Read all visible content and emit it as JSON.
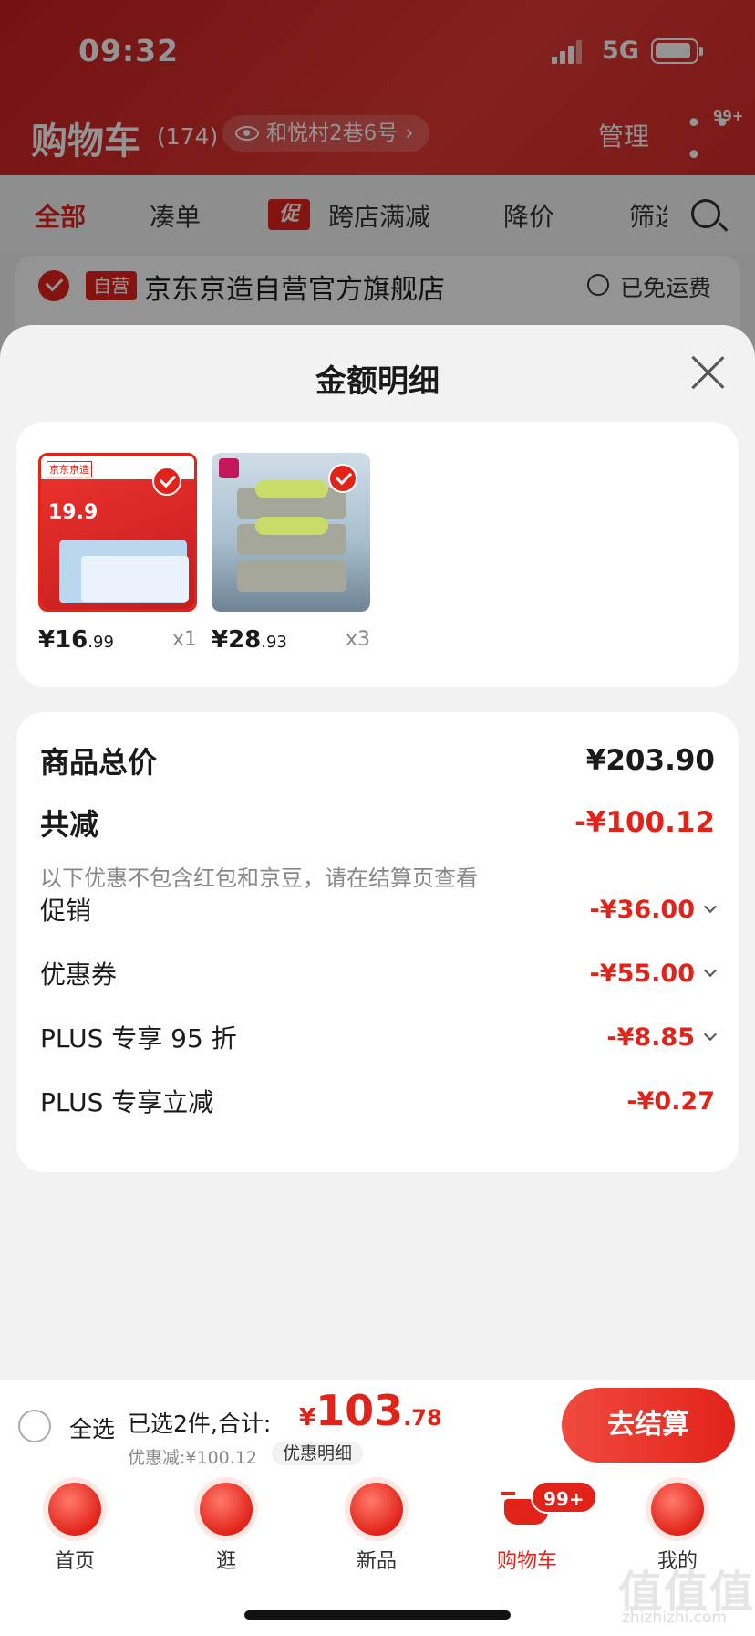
{
  "status_bar": {
    "time": "09:32",
    "network": "5G"
  },
  "cart_header": {
    "title": "购物车",
    "count": "(174)",
    "address": "和悦村2巷6号",
    "manage": "管理",
    "more_badge": "99+"
  },
  "filter_tabs": [
    {
      "label": "全部",
      "active": true
    },
    {
      "label": "凑单"
    },
    {
      "label": "跨店满减",
      "tag": "促"
    },
    {
      "label": "降价"
    },
    {
      "label": "筛选"
    }
  ],
  "store": {
    "tag": "自营",
    "name": "京东京造自营官方旗舰店",
    "shipping": "已免运费"
  },
  "sheet": {
    "title": "金额明细",
    "products": [
      {
        "price_int": "¥16",
        "price_dec": ".99",
        "qty": "x1",
        "image": "wet-wipes-pack-red-promo"
      },
      {
        "price_int": "¥28",
        "price_dec": ".93",
        "qty": "x3",
        "image": "wet-wipes-stack-blue"
      }
    ],
    "summary": {
      "total_label": "商品总价",
      "total_value": "¥203.90",
      "discount_label": "共减",
      "discount_value": "-¥100.12",
      "note": "以下优惠不包含红包和京豆，请在结算页查看",
      "items": [
        {
          "label": "促销",
          "value": "-¥36.00",
          "expandable": true
        },
        {
          "label": "优惠券",
          "value": "-¥55.00",
          "expandable": true
        },
        {
          "label": "PLUS 专享 95 折",
          "value": "-¥8.85",
          "expandable": true
        },
        {
          "label": "PLUS 专享立减",
          "value": "-¥0.27",
          "expandable": false
        }
      ]
    }
  },
  "checkout": {
    "select_all": "全选",
    "selected_text": "已选2件,合计:",
    "currency": "¥",
    "total_int": "103",
    "total_dec": ".78",
    "discount_text": "优惠减:¥100.12",
    "detail_button": "优惠明细",
    "checkout_button": "去结算"
  },
  "tabbar": {
    "items": [
      {
        "label": "首页",
        "icon": "home-icon"
      },
      {
        "label": "逛",
        "icon": "browse-icon"
      },
      {
        "label": "新品",
        "icon": "new-product-icon"
      },
      {
        "label": "购物车",
        "icon": "cart-icon",
        "active": true,
        "badge": "99+"
      },
      {
        "label": "我的",
        "icon": "profile-icon"
      }
    ]
  },
  "colors": {
    "accent": "#e2231a",
    "background": "#f2f2f2"
  },
  "watermark": {
    "logo": "值值值",
    "domain": "zhizhizhi.com"
  }
}
